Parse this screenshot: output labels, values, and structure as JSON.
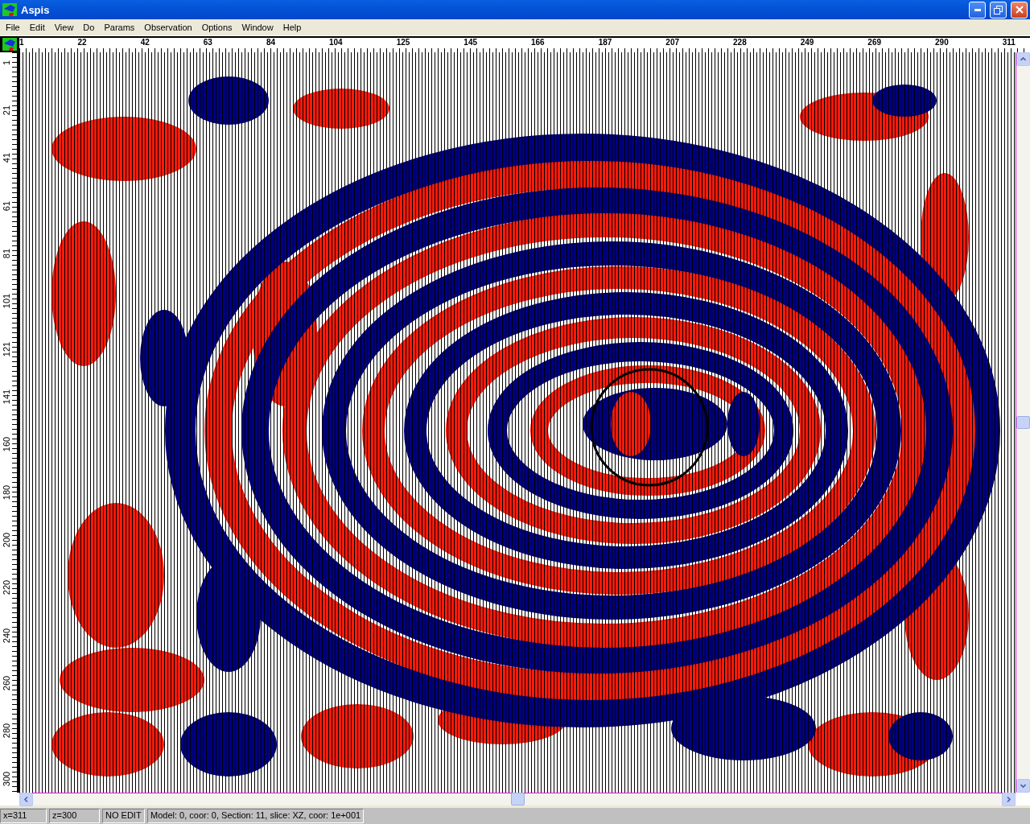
{
  "window": {
    "title": "Aspis"
  },
  "menu": [
    "File",
    "Edit",
    "View",
    "Do",
    "Params",
    "Observation",
    "Options",
    "Window",
    "Help"
  ],
  "top_ruler": {
    "labels": [
      "1",
      "22",
      "42",
      "63",
      "84",
      "104",
      "125",
      "145",
      "166",
      "187",
      "207",
      "228",
      "249",
      "269",
      "290",
      "311"
    ]
  },
  "left_ruler": {
    "labels": [
      "1",
      "21",
      "41",
      "61",
      "81",
      "101",
      "121",
      "141",
      "160",
      "180",
      "200",
      "220",
      "240",
      "260",
      "280",
      "300"
    ]
  },
  "status_bar": [
    "x=311",
    "z=300",
    "NO EDIT",
    "Model: 0, coor: 0, Section: 11, slice: XZ, coor: 1e+001"
  ]
}
